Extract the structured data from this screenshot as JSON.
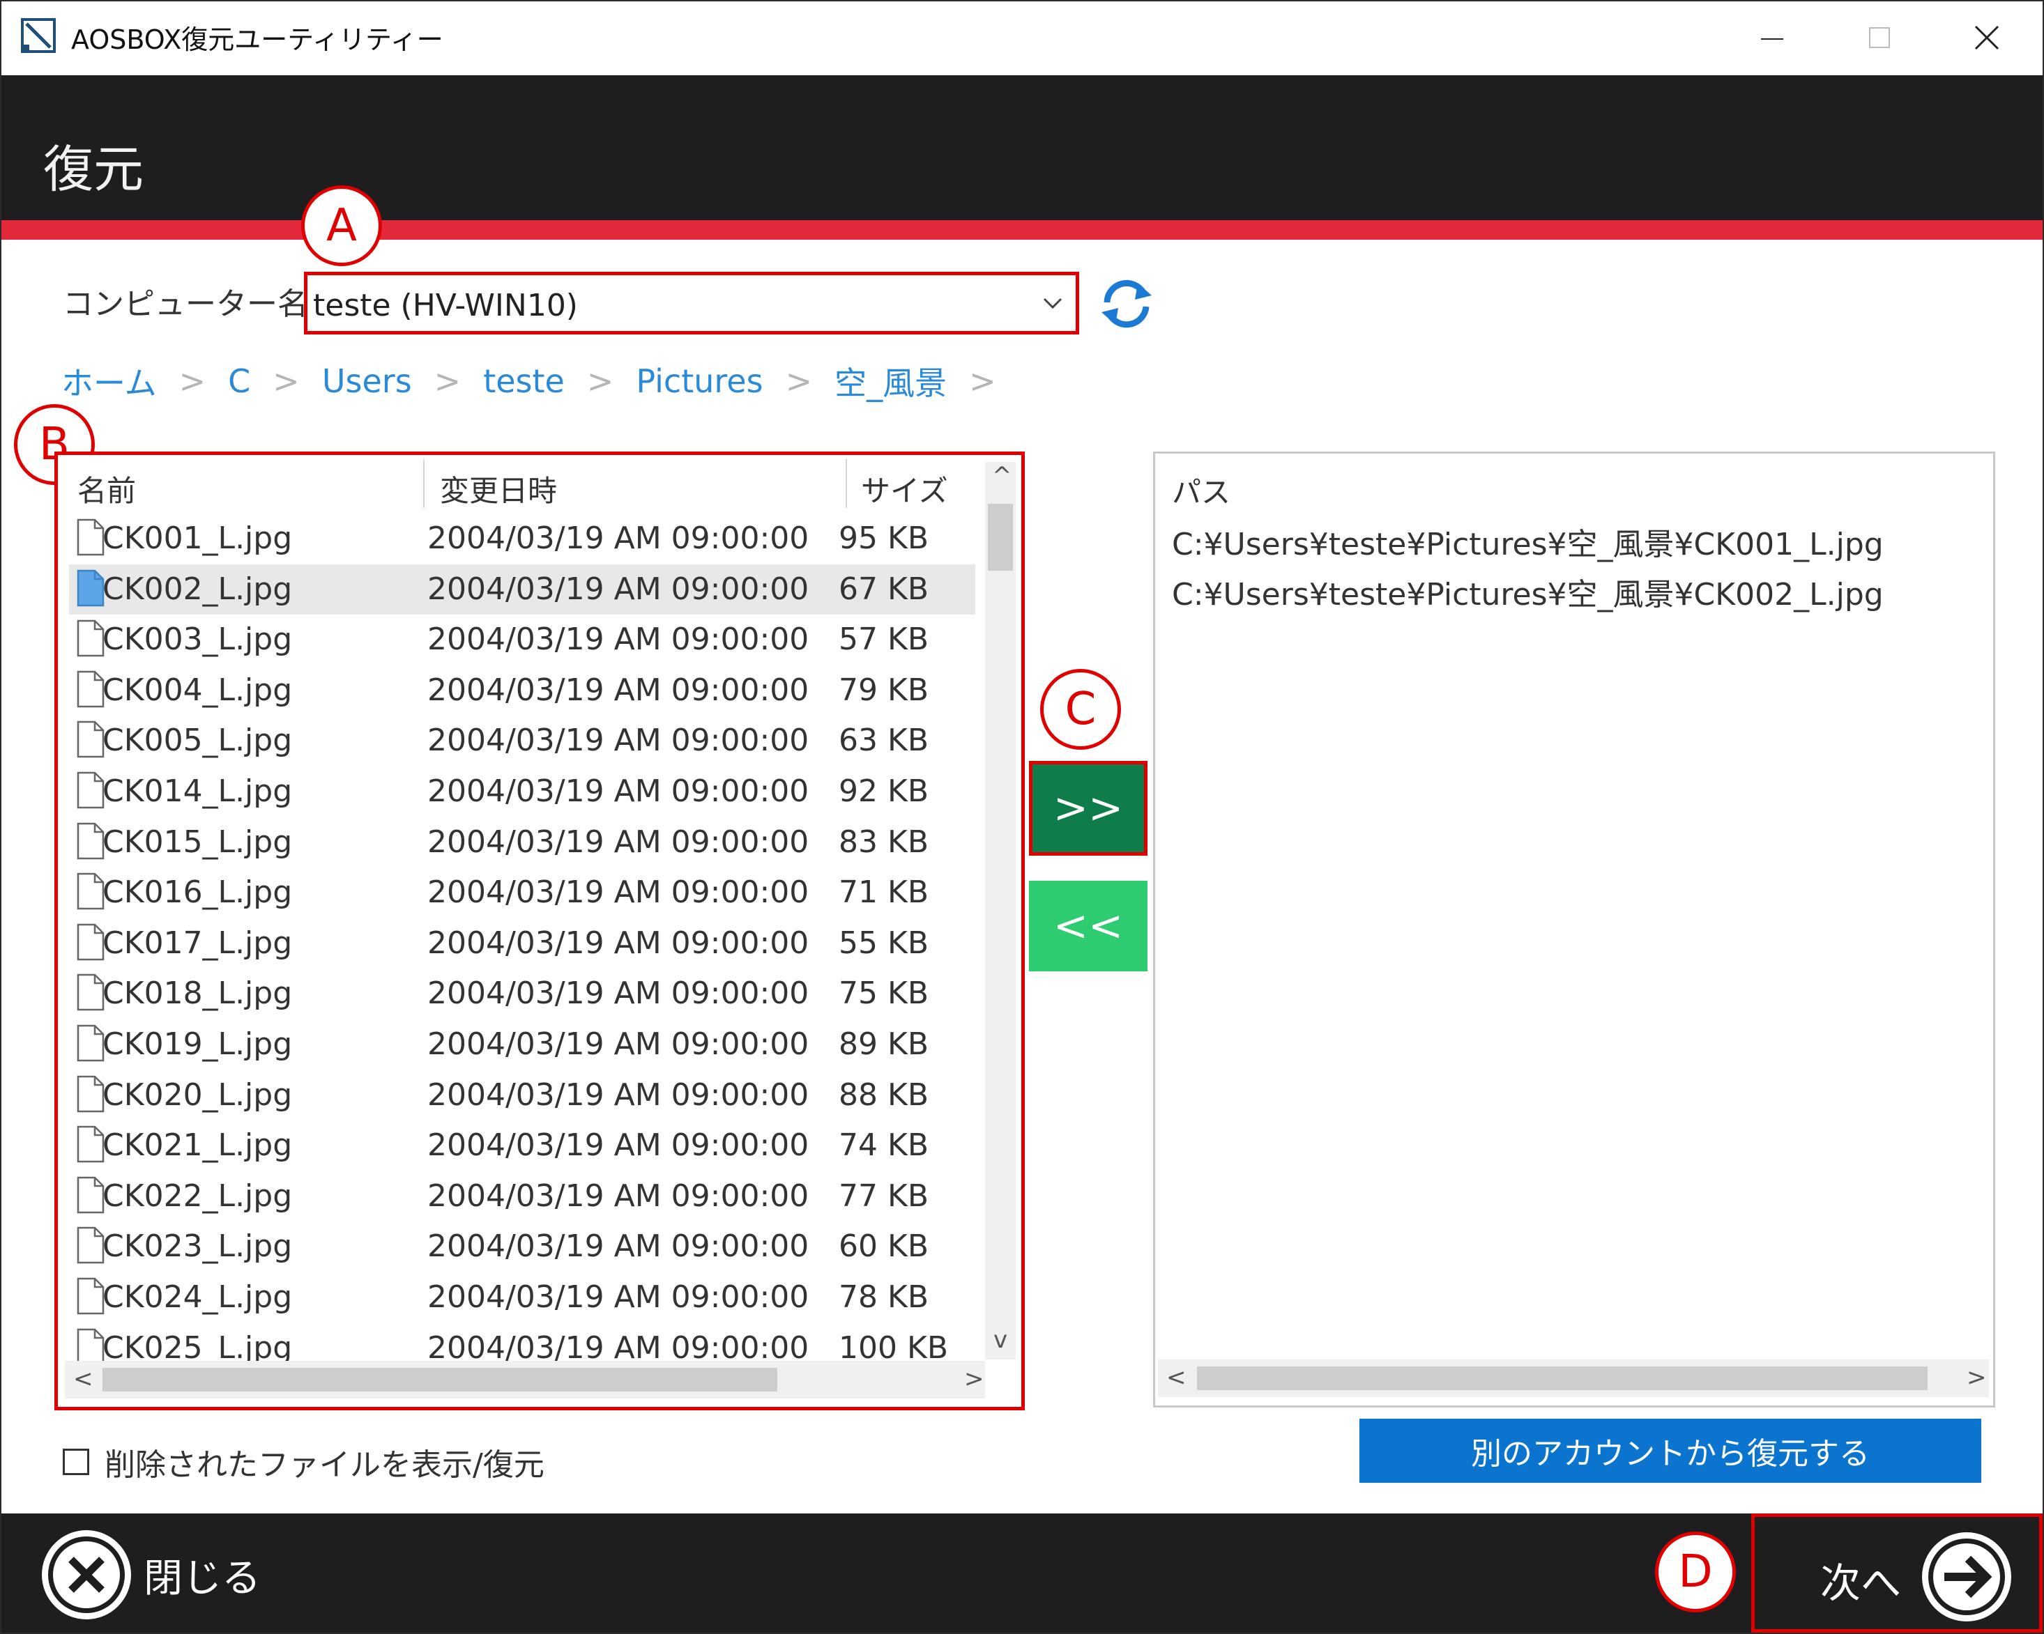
{
  "window": {
    "title": "AOSBOX復元ユーティリティー",
    "controls": {
      "minimize": "minimize",
      "maximize": "maximize",
      "close": "close"
    }
  },
  "header": {
    "title": "復元",
    "accent_color": "#e3293a"
  },
  "computer": {
    "label": "コンピューター名:",
    "selected": "teste (HV-WIN10)"
  },
  "breadcrumb": {
    "items": [
      "ホーム",
      "C",
      "Users",
      "teste",
      "Pictures",
      "空_風景"
    ],
    "separator": ">"
  },
  "markers": {
    "a": "A",
    "b": "B",
    "c": "C",
    "d": "D"
  },
  "file_list": {
    "columns": {
      "name": "名前",
      "modified": "変更日時",
      "size": "サイズ"
    },
    "rows": [
      {
        "name": "CK001_L.jpg",
        "modified": "2004/03/19 AM 09:00:00",
        "size": "95 KB"
      },
      {
        "name": "CK002_L.jpg",
        "modified": "2004/03/19 AM 09:00:00",
        "size": "67 KB"
      },
      {
        "name": "CK003_L.jpg",
        "modified": "2004/03/19 AM 09:00:00",
        "size": "57 KB"
      },
      {
        "name": "CK004_L.jpg",
        "modified": "2004/03/19 AM 09:00:00",
        "size": "79 KB"
      },
      {
        "name": "CK005_L.jpg",
        "modified": "2004/03/19 AM 09:00:00",
        "size": "63 KB"
      },
      {
        "name": "CK014_L.jpg",
        "modified": "2004/03/19 AM 09:00:00",
        "size": "92 KB"
      },
      {
        "name": "CK015_L.jpg",
        "modified": "2004/03/19 AM 09:00:00",
        "size": "83 KB"
      },
      {
        "name": "CK016_L.jpg",
        "modified": "2004/03/19 AM 09:00:00",
        "size": "71 KB"
      },
      {
        "name": "CK017_L.jpg",
        "modified": "2004/03/19 AM 09:00:00",
        "size": "55 KB"
      },
      {
        "name": "CK018_L.jpg",
        "modified": "2004/03/19 AM 09:00:00",
        "size": "75 KB"
      },
      {
        "name": "CK019_L.jpg",
        "modified": "2004/03/19 AM 09:00:00",
        "size": "89 KB"
      },
      {
        "name": "CK020_L.jpg",
        "modified": "2004/03/19 AM 09:00:00",
        "size": "88 KB"
      },
      {
        "name": "CK021_L.jpg",
        "modified": "2004/03/19 AM 09:00:00",
        "size": "74 KB"
      },
      {
        "name": "CK022_L.jpg",
        "modified": "2004/03/19 AM 09:00:00",
        "size": "77 KB"
      },
      {
        "name": "CK023_L.jpg",
        "modified": "2004/03/19 AM 09:00:00",
        "size": "60 KB"
      },
      {
        "name": "CK024_L.jpg",
        "modified": "2004/03/19 AM 09:00:00",
        "size": "78 KB"
      },
      {
        "name": "CK025_L.jpg",
        "modified": "2004/03/19 AM 09:00:00",
        "size": "100 KB"
      }
    ],
    "selected_index": 1
  },
  "transfer": {
    "add_label": ">>",
    "remove_label": "<<",
    "add_color": "#0e7d4a",
    "remove_color": "#2ecc71"
  },
  "path_list": {
    "header": "パス",
    "rows": [
      "C:¥Users¥teste¥Pictures¥空_風景¥CK001_L.jpg",
      "C:¥Users¥teste¥Pictures¥空_風景¥CK002_L.jpg"
    ]
  },
  "options": {
    "show_deleted_label": "削除されたファイルを表示/復元",
    "show_deleted_checked": false
  },
  "other_account_button": "別のアカウントから復元する",
  "footer": {
    "close_label": "閉じる",
    "next_label": "次へ"
  },
  "scroll_arrows": {
    "up": "^",
    "down": "v",
    "left": "<",
    "right": ">"
  }
}
